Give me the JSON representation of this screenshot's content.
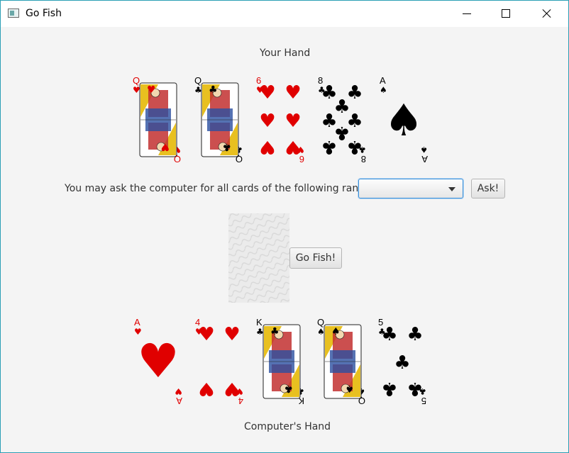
{
  "window": {
    "title": "Go Fish"
  },
  "your_hand": {
    "label": "Your Hand",
    "cards": [
      {
        "rank": "Q",
        "suit": "hearts"
      },
      {
        "rank": "Q",
        "suit": "clubs"
      },
      {
        "rank": "6",
        "suit": "hearts"
      },
      {
        "rank": "8",
        "suit": "clubs"
      },
      {
        "rank": "A",
        "suit": "spades"
      }
    ]
  },
  "ask": {
    "prompt": "You may ask the computer for all cards of the following rank:",
    "selected": "",
    "button": "Ask!"
  },
  "deck": {
    "button": "Go Fish!"
  },
  "computer_hand": {
    "label": "Computer's Hand",
    "cards": [
      {
        "rank": "A",
        "suit": "hearts"
      },
      {
        "rank": "4",
        "suit": "hearts"
      },
      {
        "rank": "K",
        "suit": "clubs"
      },
      {
        "rank": "Q",
        "suit": "spades"
      },
      {
        "rank": "5",
        "suit": "clubs"
      }
    ]
  },
  "colors": {
    "red": "#e00000",
    "black": "#000000",
    "accent": "#3a8fd8"
  }
}
